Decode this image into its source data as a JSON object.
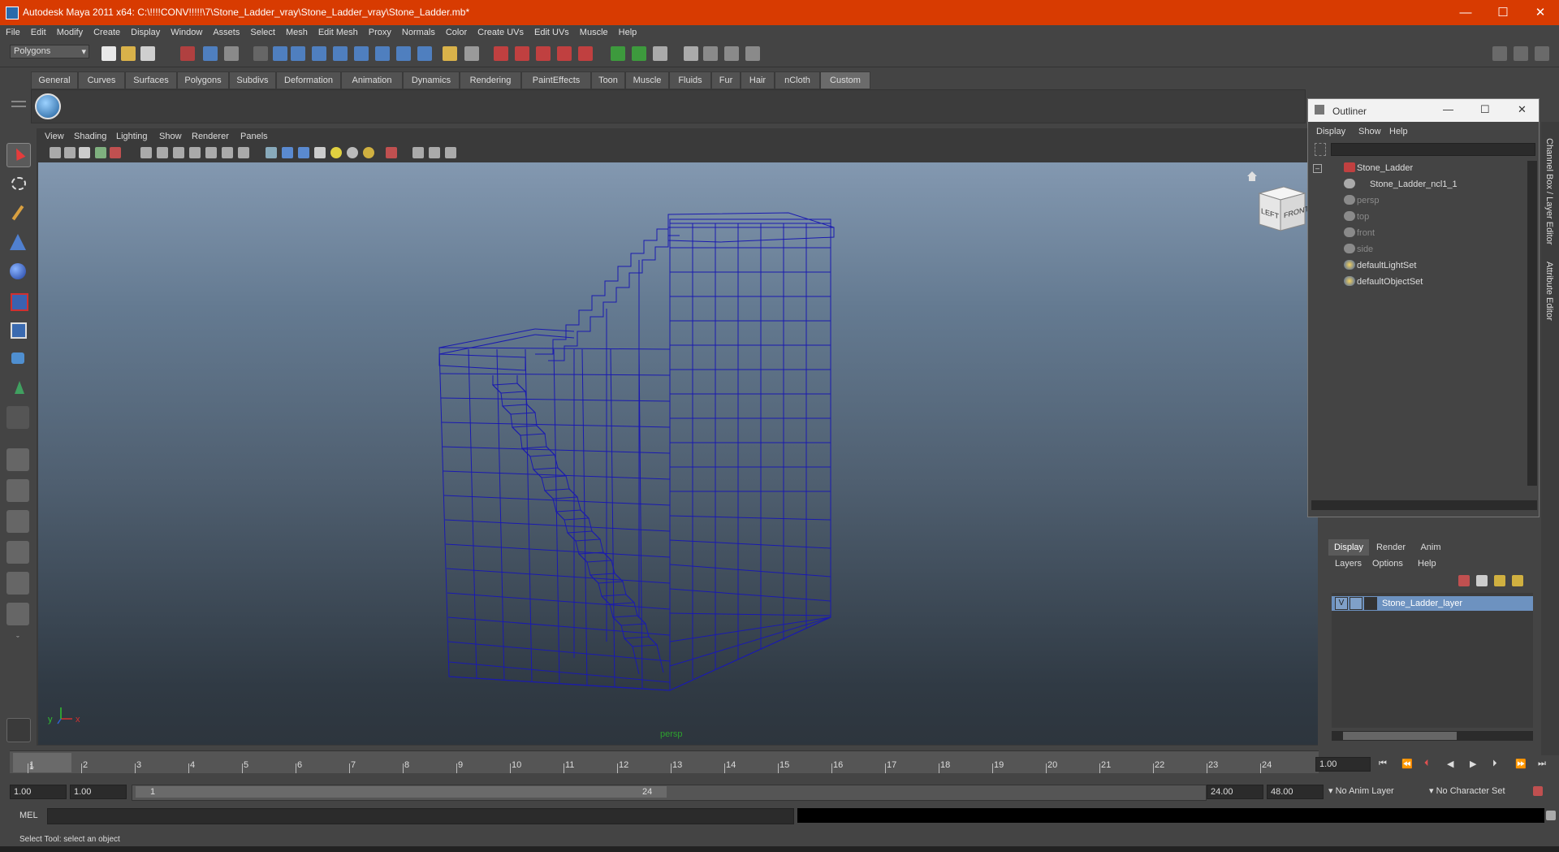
{
  "window": {
    "title": "Autodesk Maya 2011 x64: C:\\!!!!CONV!!!!!\\7\\Stone_Ladder_vray\\Stone_Ladder_vray\\Stone_Ladder.mb*",
    "minimize": "—",
    "maximize": "☐",
    "close": "✕"
  },
  "menu": [
    "File",
    "Edit",
    "Modify",
    "Create",
    "Display",
    "Window",
    "Assets",
    "Select",
    "Mesh",
    "Edit Mesh",
    "Proxy",
    "Normals",
    "Color",
    "Create UVs",
    "Edit UVs",
    "Muscle",
    "Help"
  ],
  "mode_selector": "Polygons",
  "shelf_tabs": [
    "General",
    "Curves",
    "Surfaces",
    "Polygons",
    "Subdivs",
    "Deformation",
    "Animation",
    "Dynamics",
    "Rendering",
    "PaintEffects",
    "Toon",
    "Muscle",
    "Fluids",
    "Fur",
    "Hair",
    "nCloth",
    "Custom"
  ],
  "active_shelf_tab": "Custom",
  "panel_menu": [
    "View",
    "Shading",
    "Lighting",
    "Show",
    "Renderer",
    "Panels"
  ],
  "viewport": {
    "camera_name": "persp",
    "viewcube_left": "LEFT",
    "viewcube_front": "FRONT",
    "axis_x": "x",
    "axis_y": "y"
  },
  "timeline": {
    "ticks": [
      "1",
      "2",
      "3",
      "4",
      "5",
      "6",
      "7",
      "8",
      "9",
      "10",
      "11",
      "12",
      "13",
      "14",
      "15",
      "16",
      "17",
      "18",
      "19",
      "20",
      "21",
      "22",
      "23",
      "24"
    ],
    "current_marker": "1",
    "current_time": "1.00"
  },
  "range": {
    "start": "1.00",
    "playback_start": "1.00",
    "slider_start": "1",
    "slider_end": "24",
    "playback_end": "24.00",
    "end": "48.00",
    "anim_layer": "No Anim Layer",
    "character_set": "No Character Set"
  },
  "command_line": {
    "label": "MEL"
  },
  "help_line": "Select Tool: select an object",
  "outliner": {
    "title": "Outliner",
    "menu": [
      "Display",
      "Show",
      "Help"
    ],
    "items": [
      {
        "label": "Stone_Ladder"
      },
      {
        "label": "Stone_Ladder_ncl1_1"
      },
      {
        "label": "persp"
      },
      {
        "label": "top"
      },
      {
        "label": "front"
      },
      {
        "label": "side"
      },
      {
        "label": "defaultLightSet"
      },
      {
        "label": "defaultObjectSet"
      }
    ]
  },
  "side_tabs": {
    "channel_box": "Channel Box / Layer Editor",
    "attribute_editor": "Attribute Editor"
  },
  "layer_editor": {
    "tabs": [
      "Display",
      "Render",
      "Anim"
    ],
    "active_tab": "Display",
    "menu": [
      "Layers",
      "Options",
      "Help"
    ],
    "layer": {
      "visible": "V",
      "name": "Stone_Ladder_layer"
    }
  },
  "colors": {
    "title_bar": "#d83b01",
    "wireframe": "#1a1ab0",
    "layer_selected": "#6d92c0"
  }
}
